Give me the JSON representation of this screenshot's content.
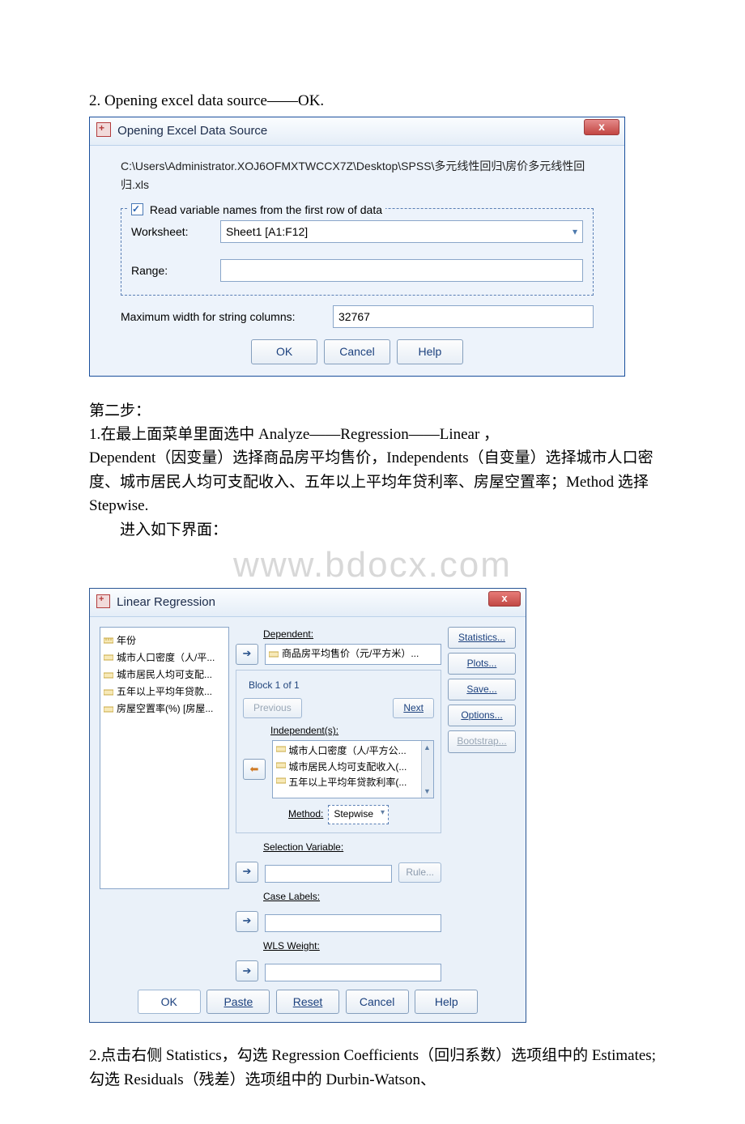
{
  "intro_line": "2. Opening excel data source——OK.",
  "dialog1": {
    "title": "Opening Excel Data Source",
    "close": "x",
    "path": "C:\\Users\\Administrator.XOJ6OFMXTWCCX7Z\\Desktop\\SPSS\\多元线性回归\\房价多元线性回归.xls",
    "checkbox_label": "Read variable names from the first row of data",
    "worksheet_label": "Worksheet:",
    "worksheet_value": "Sheet1 [A1:F12]",
    "range_label": "Range:",
    "range_value": "",
    "maxw_label": "Maximum width for string columns:",
    "maxw_value": "32767",
    "ok": "OK",
    "cancel": "Cancel",
    "help": "Help"
  },
  "para": {
    "step_title": "第二步：",
    "l1": "1.在最上面菜单里面选中 Analyze——Regression——Linear ，",
    "l2": "Dependent（因变量）选择商品房平均售价，Independents（自变量）选择城市人口密度、城市居民人均可支配收入、五年以上平均年贷利率、房屋空置率；Method 选择 Stepwise.",
    "l3": "进入如下界面："
  },
  "watermark": "www.bdocx.com",
  "dialog2": {
    "title": "Linear Regression",
    "close": "x",
    "vars": [
      "年份",
      "城市人口密度（人/平...",
      "城市居民人均可支配...",
      "五年以上平均年贷款...",
      "房屋空置率(%) [房屋..."
    ],
    "dep_label": "Dependent:",
    "dep_value": "商品房平均售价（元/平方米）...",
    "block_legend": "Block 1 of 1",
    "prev": "Previous",
    "next": "Next",
    "indep_label": "Independent(s):",
    "indep_items": [
      "城市人口密度（人/平方公...",
      "城市居民人均可支配收入(...",
      "五年以上平均年贷款利率(..."
    ],
    "method_label": "Method:",
    "method_value": "Stepwise",
    "selvar_label": "Selection Variable:",
    "rule": "Rule...",
    "caselab": "Case Labels:",
    "wls": "WLS Weight:",
    "side": {
      "stats": "Statistics...",
      "plots": "Plots...",
      "save": "Save...",
      "options": "Options...",
      "bootstrap": "Bootstrap..."
    },
    "ok": "OK",
    "paste": "Paste",
    "reset": "Reset",
    "cancel": "Cancel",
    "help": "Help"
  },
  "after": {
    "l1": "2.点击右侧 Statistics，勾选 Regression Coefficients（回归系数）选项组中的 Estimates;勾选 Residuals（残差）选项组中的 Durbin-Watson、"
  }
}
